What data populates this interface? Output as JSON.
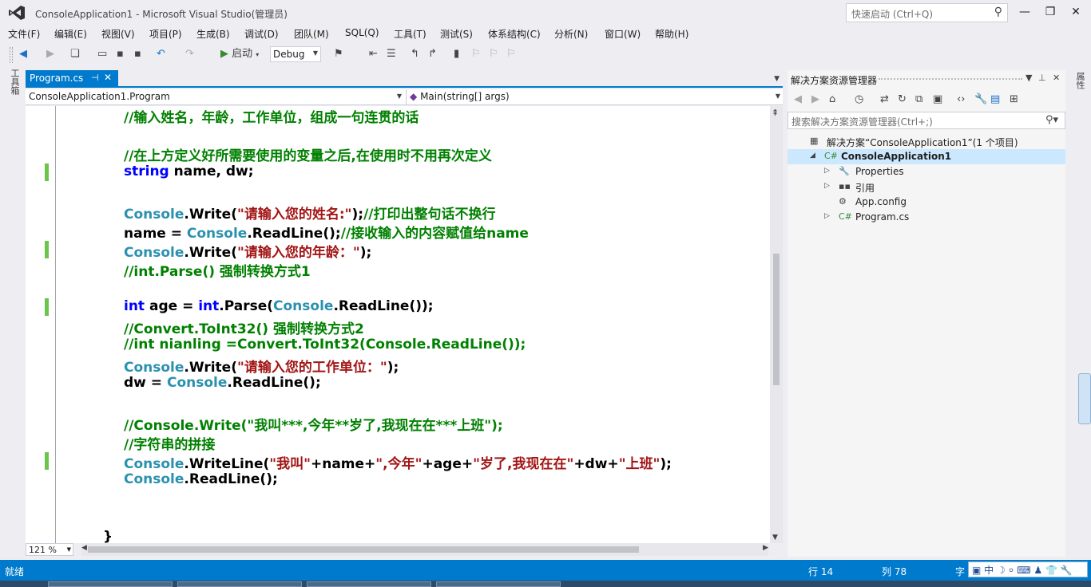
{
  "window": {
    "title": "ConsoleApplication1 - Microsoft Visual Studio(管理员)",
    "quick_launch_placeholder": "快速启动 (Ctrl+Q)"
  },
  "menu": [
    "文件(F)",
    "编辑(E)",
    "视图(V)",
    "项目(P)",
    "生成(B)",
    "调试(D)",
    "团队(M)",
    "SQL(Q)",
    "工具(T)",
    "测试(S)",
    "体系结构(C)",
    "分析(N)",
    "窗口(W)",
    "帮助(H)"
  ],
  "toolbar": {
    "start_label": "启动",
    "configuration": "Debug"
  },
  "toolbox_label": "工具箱",
  "editor": {
    "tab_label": "Program.cs",
    "nav_class": "ConsoleApplication1.Program",
    "nav_member": "Main(string[] args)",
    "zoom": "121 %",
    "code_lines": [
      [
        {
          "t": "cm",
          "v": "//输入姓名，年龄，工作单位，组成一句连贯的话"
        }
      ],
      [],
      [
        {
          "t": "cm",
          "v": "//在上方定义好所需要使用的变量之后,在使用时不用再次定义"
        }
      ],
      [
        {
          "t": "kw",
          "v": "string"
        },
        {
          "t": "tx",
          "v": " name, dw;"
        }
      ],
      [],
      [
        {
          "t": "ty",
          "v": "Console"
        },
        {
          "t": "tx",
          "v": ".Write("
        },
        {
          "t": "st",
          "v": "\"请输入您的姓名:\""
        },
        {
          "t": "tx",
          "v": ");"
        },
        {
          "t": "cm",
          "v": "//打印出整句话不换行"
        }
      ],
      [
        {
          "t": "tx",
          "v": "name = "
        },
        {
          "t": "ty",
          "v": "Console"
        },
        {
          "t": "tx",
          "v": ".ReadLine();"
        },
        {
          "t": "cm",
          "v": "//接收输入的内容赋值给name"
        }
      ],
      [
        {
          "t": "ty",
          "v": "Console"
        },
        {
          "t": "tx",
          "v": ".Write("
        },
        {
          "t": "st",
          "v": "\"请输入您的年龄：\""
        },
        {
          "t": "tx",
          "v": ");"
        }
      ],
      [
        {
          "t": "cm",
          "v": "//int.Parse() 强制转换方式1"
        }
      ],
      [],
      [
        {
          "t": "kw",
          "v": "int"
        },
        {
          "t": "tx",
          "v": " age = "
        },
        {
          "t": "kw",
          "v": "int"
        },
        {
          "t": "tx",
          "v": ".Parse("
        },
        {
          "t": "ty",
          "v": "Console"
        },
        {
          "t": "tx",
          "v": ".ReadLine());"
        }
      ],
      [
        {
          "t": "cm",
          "v": "//Convert.ToInt32() 强制转换方式2"
        }
      ],
      [
        {
          "t": "cm",
          "v": "//int nianling =Convert.ToInt32(Console.ReadLine());"
        }
      ],
      [
        {
          "t": "ty",
          "v": "Console"
        },
        {
          "t": "tx",
          "v": ".Write("
        },
        {
          "t": "st",
          "v": "\"请输入您的工作单位：\""
        },
        {
          "t": "tx",
          "v": ");"
        }
      ],
      [
        {
          "t": "tx",
          "v": "dw = "
        },
        {
          "t": "ty",
          "v": "Console"
        },
        {
          "t": "tx",
          "v": ".ReadLine();"
        }
      ],
      [],
      [
        {
          "t": "cm",
          "v": "//Console.Write(\"我叫***,今年**岁了,我现在在***上班\");"
        }
      ],
      [
        {
          "t": "cm",
          "v": "//字符串的拼接"
        }
      ],
      [
        {
          "t": "ty",
          "v": "Console"
        },
        {
          "t": "tx",
          "v": ".WriteLine("
        },
        {
          "t": "st",
          "v": "\"我叫\""
        },
        {
          "t": "tx",
          "v": "+name+"
        },
        {
          "t": "st",
          "v": "\",今年\""
        },
        {
          "t": "tx",
          "v": "+age+"
        },
        {
          "t": "st",
          "v": "\"岁了,我现在在\""
        },
        {
          "t": "tx",
          "v": "+dw+"
        },
        {
          "t": "st",
          "v": "\"上班\""
        },
        {
          "t": "tx",
          "v": ");"
        }
      ],
      [
        {
          "t": "ty",
          "v": "Console"
        },
        {
          "t": "tx",
          "v": ".ReadLine();"
        }
      ],
      [],
      [],
      [
        {
          "t": "tx",
          "v": "}"
        }
      ]
    ],
    "changed_lines": [
      3,
      7,
      10,
      18
    ]
  },
  "solution_explorer": {
    "title": "解决方案资源管理器",
    "search_placeholder": "搜索解决方案资源管理器(Ctrl+;)",
    "items": [
      {
        "label": "解决方案“ConsoleApplication1”(1 个项目)",
        "icon": "solution-icon",
        "expander": "",
        "selected": false
      },
      {
        "label": "ConsoleApplication1",
        "icon": "csharp-project-icon",
        "expander": "◢",
        "selected": true
      },
      {
        "label": "Properties",
        "icon": "wrench-icon",
        "expander": "▷",
        "selected": false
      },
      {
        "label": "引用",
        "icon": "references-icon",
        "expander": "▷",
        "selected": false
      },
      {
        "label": "App.config",
        "icon": "config-file-icon",
        "expander": "",
        "selected": false
      },
      {
        "label": "Program.cs",
        "icon": "csharp-file-icon",
        "expander": "▷",
        "selected": false
      }
    ]
  },
  "right_strip_label": "属性",
  "status": {
    "text": "就绪",
    "line": "行 14",
    "col": "列 78",
    "char": "字",
    "ime": "中"
  },
  "colors": {
    "accent": "#007acc",
    "comment": "#008000",
    "keyword": "#0000ff",
    "type": "#2b91af",
    "string": "#a31515",
    "change_marker": "#6cc44a"
  }
}
